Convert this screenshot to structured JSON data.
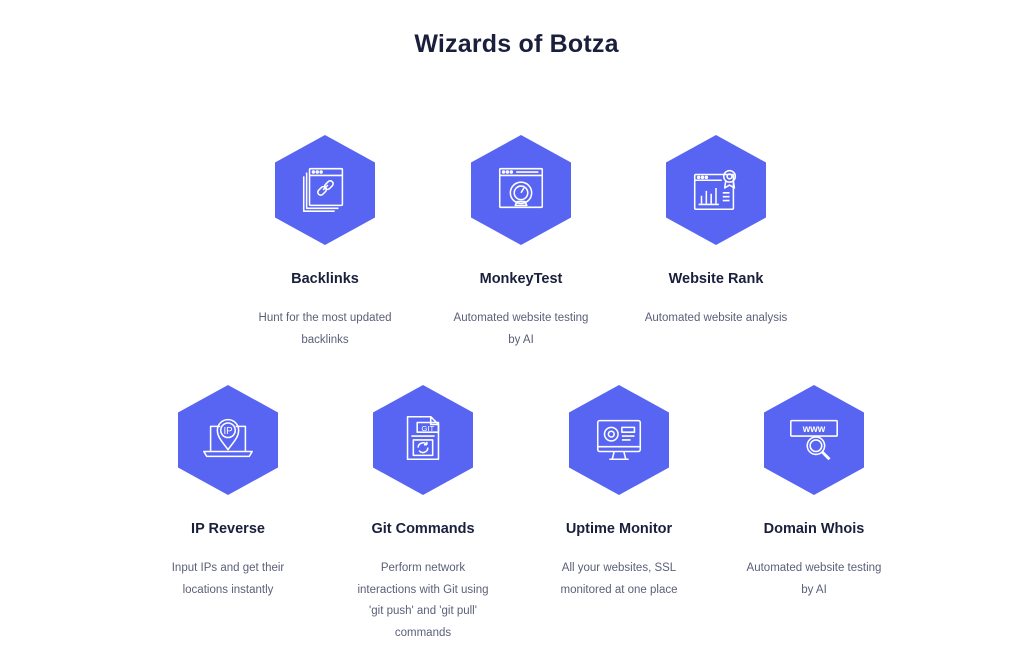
{
  "page": {
    "title": "Wizards of Botza"
  },
  "colors": {
    "accent": "#5865f2",
    "heading": "#1a1f3c",
    "text": "#5c6078"
  },
  "cards": [
    {
      "icon": "backlinks-icon",
      "title": "Backlinks",
      "desc_lines": [
        "Hunt for the most updated",
        "backlinks"
      ]
    },
    {
      "icon": "speedometer-icon",
      "title": "MonkeyTest",
      "desc_lines": [
        "Automated website testing",
        "by AI"
      ]
    },
    {
      "icon": "website-rank-icon",
      "title": "Website Rank",
      "desc_lines": [
        "Automated website analysis"
      ]
    },
    {
      "icon": "ip-location-icon",
      "title": "IP Reverse",
      "desc_lines": [
        "Input IPs and get their",
        "locations instantly"
      ]
    },
    {
      "icon": "git-file-icon",
      "title": "Git Commands",
      "desc_lines": [
        "Perform network",
        "interactions with Git using",
        "'git push' and 'git pull'",
        "commands"
      ]
    },
    {
      "icon": "monitor-icon",
      "title": "Uptime Monitor",
      "desc_lines": [
        "All your websites, SSL",
        "monitored at one place"
      ]
    },
    {
      "icon": "www-search-icon",
      "title": "Domain Whois",
      "desc_lines": [
        "Automated website testing",
        "by AI"
      ]
    }
  ]
}
